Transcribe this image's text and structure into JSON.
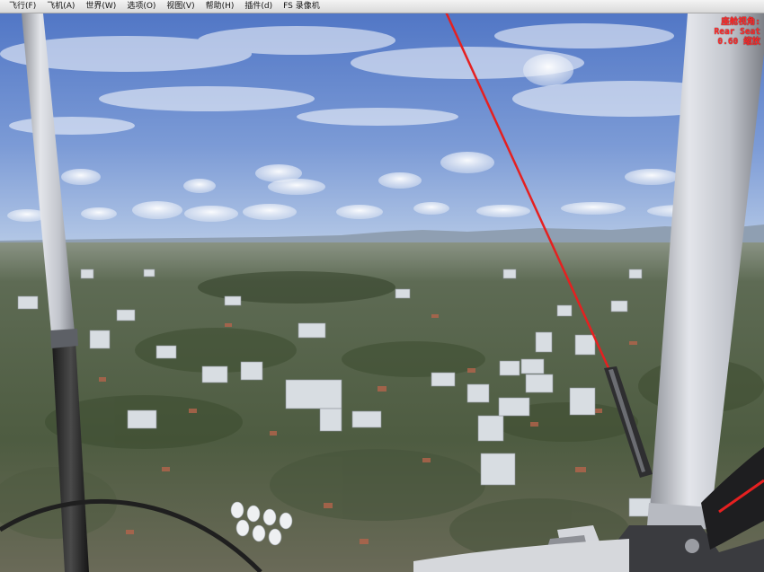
{
  "menu": [
    {
      "label": "飞行(F)"
    },
    {
      "label": "飞机(A)"
    },
    {
      "label": "世界(W)"
    },
    {
      "label": "选项(O)"
    },
    {
      "label": "视图(V)"
    },
    {
      "label": "帮助(H)"
    },
    {
      "label": "插件(d)"
    },
    {
      "label": "FS 录像机"
    }
  ],
  "hud": {
    "line1": "座舱视角:",
    "line2": "Rear Seat",
    "line3": "0.60 缩放"
  },
  "colors": {
    "sky_top": "#5077c8",
    "sky_horizon": "#a9c2e6",
    "ground": "#56654a",
    "hud_text": "#ff2a2a",
    "strut": "#c5c8cf",
    "rope": "#e52020"
  }
}
